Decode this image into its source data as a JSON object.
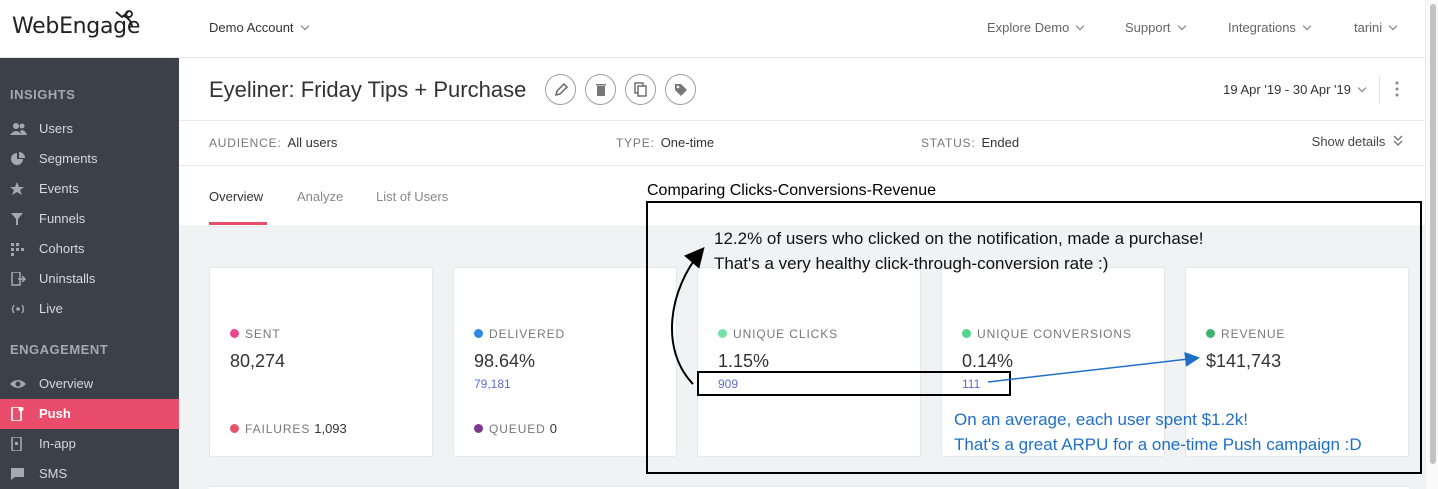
{
  "brand": {
    "logo_text": "WebEngage"
  },
  "topbar": {
    "account": "Demo Account",
    "nav": [
      "Explore Demo",
      "Support",
      "Integrations",
      "tarini"
    ]
  },
  "sidebar": {
    "insights_heading": "INSIGHTS",
    "insights": [
      "Users",
      "Segments",
      "Events",
      "Funnels",
      "Cohorts",
      "Uninstalls",
      "Live"
    ],
    "engagement_heading": "ENGAGEMENT",
    "engagement": [
      "Overview",
      "Push",
      "In-app",
      "SMS"
    ],
    "active": "Push"
  },
  "campaign": {
    "title": "Eyeliner: Friday Tips + Purchase",
    "date_range": "19 Apr '19 - 30 Apr '19"
  },
  "meta": {
    "audience_label": "AUDIENCE:",
    "audience_value": "All users",
    "type_label": "TYPE:",
    "type_value": "One-time",
    "status_label": "STATUS:",
    "status_value": "Ended",
    "show_details": "Show details"
  },
  "tabs": [
    "Overview",
    "Analyze",
    "List of Users"
  ],
  "cards": {
    "sent": {
      "label": "SENT",
      "value": "80,274",
      "sub_label": "FAILURES",
      "sub_value": "1,093"
    },
    "delivered": {
      "label": "DELIVERED",
      "value": "98.64%",
      "count": "79,181",
      "sub_label": "QUEUED",
      "sub_value": "0"
    },
    "unique_clicks": {
      "label": "UNIQUE CLICKS",
      "value": "1.15%",
      "count": "909"
    },
    "unique_conversions": {
      "label": "UNIQUE CONVERSIONS",
      "value": "0.14%",
      "count": "111"
    },
    "revenue": {
      "label": "REVENUE",
      "value": "$141,743"
    }
  },
  "colors": {
    "sent": "#e8478f",
    "failures": "#e5566b",
    "delivered": "#2d88e8",
    "queued": "#7b3a8c",
    "clicks": "#74e3a6",
    "conversions": "#4fd68c",
    "revenue": "#3fb36e",
    "accent": "#ea4d6b"
  },
  "annotations": {
    "box_title": "Comparing Clicks-Conversions-Revenue",
    "clicks_note_1": "12.2% of users who clicked on the notification, made a purchase!",
    "clicks_note_2": "That's a very healthy click-through-conversion rate :)",
    "arpu_note_1": "On an average, each user spent $1.2k!",
    "arpu_note_2": "That's a great ARPU for a one-time Push campaign :D"
  }
}
